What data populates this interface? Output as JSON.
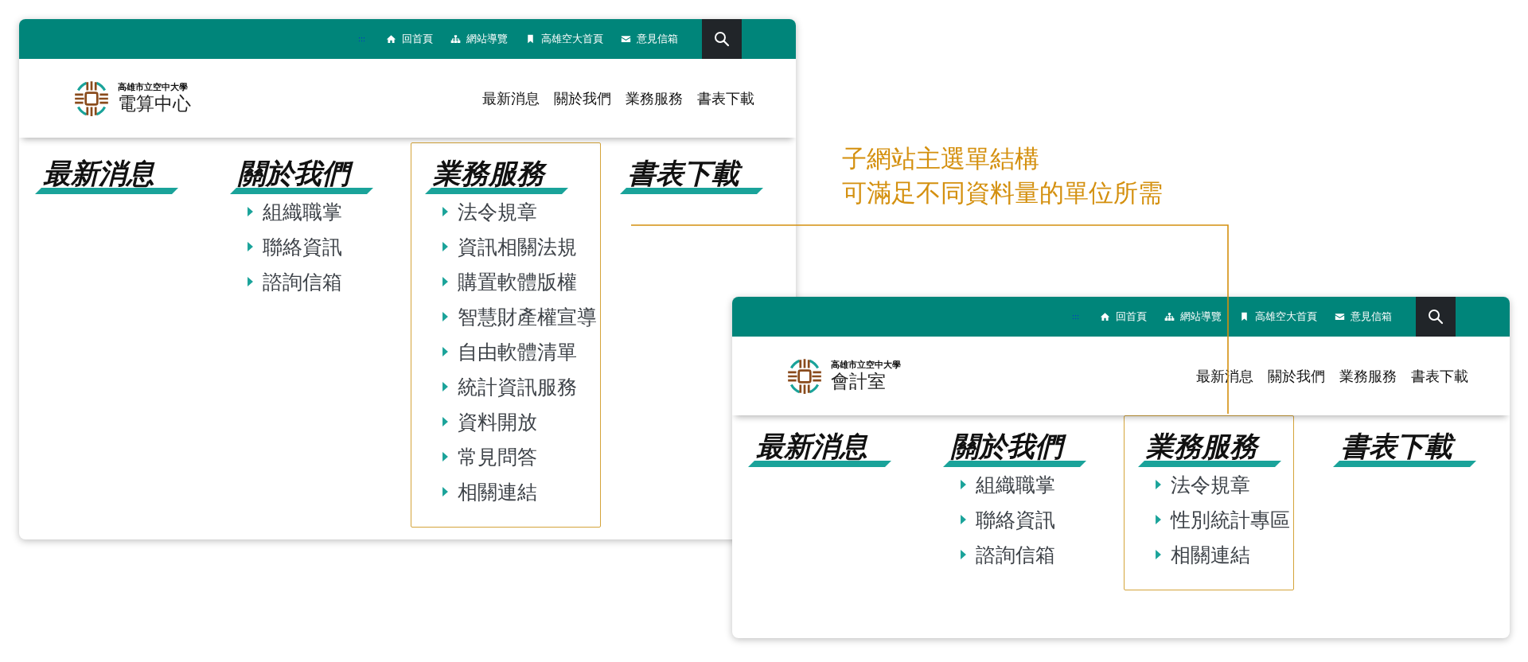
{
  "annotation": {
    "lines": [
      "子網站主選單結構",
      "可滿足不同資料量的單位所需"
    ]
  },
  "sites": [
    {
      "top_bar": {
        "accesskey": ":::",
        "links": [
          {
            "kind": "home",
            "label": "回首頁"
          },
          {
            "kind": "sitemap",
            "label": "網站導覽"
          },
          {
            "kind": "bookmark",
            "label": "高雄空大首頁"
          },
          {
            "kind": "mail",
            "label": "意見信箱"
          }
        ]
      },
      "logo": {
        "org": "高雄市立空中大學",
        "unit": "電算中心"
      },
      "nav": [
        "最新消息",
        "關於我們",
        "業務服務",
        "書表下載"
      ],
      "mega_menu": [
        {
          "title": "最新消息",
          "highlighted": false
        },
        {
          "title": "關於我們",
          "highlighted": false,
          "items": [
            "組織職掌",
            "聯絡資訊",
            "諮詢信箱"
          ]
        },
        {
          "title": "業務服務",
          "highlighted": true,
          "items": [
            "法令規章",
            "資訊相關法規",
            "購置軟體版權",
            "智慧財產權宣導",
            "自由軟體清單",
            "統計資訊服務",
            "資料開放",
            "常見問答",
            "相關連結"
          ]
        },
        {
          "title": "書表下載",
          "highlighted": false
        }
      ]
    },
    {
      "top_bar": {
        "accesskey": ":::",
        "links": [
          {
            "kind": "home",
            "label": "回首頁"
          },
          {
            "kind": "sitemap",
            "label": "網站導覽"
          },
          {
            "kind": "bookmark",
            "label": "高雄空大首頁"
          },
          {
            "kind": "mail",
            "label": "意見信箱"
          }
        ]
      },
      "logo": {
        "org": "高雄市立空中大學",
        "unit": "會計室"
      },
      "nav": [
        "最新消息",
        "關於我們",
        "業務服務",
        "書表下載"
      ],
      "mega_menu": [
        {
          "title": "最新消息",
          "highlighted": false
        },
        {
          "title": "關於我們",
          "highlighted": false,
          "items": [
            "組織職掌",
            "聯絡資訊",
            "諮詢信箱"
          ]
        },
        {
          "title": "業務服務",
          "highlighted": true,
          "items": [
            "法令規章",
            "性別統計專區",
            "相關連結"
          ]
        },
        {
          "title": "書表下載",
          "highlighted": false
        }
      ]
    }
  ]
}
